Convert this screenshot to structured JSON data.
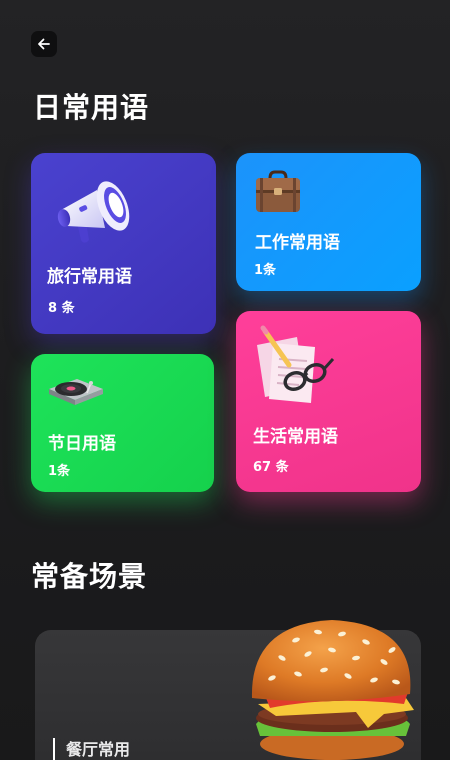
{
  "header": {
    "back_icon": "arrow-left-icon"
  },
  "daily": {
    "title": "日常用语",
    "cards": [
      {
        "label": "旅行常用语",
        "count": "8 条",
        "icon": "megaphone-icon",
        "color": "#4338ca"
      },
      {
        "label": "工作常用语",
        "count": "1条",
        "icon": "briefcase-icon",
        "color": "#0ea5ff"
      },
      {
        "label": "节日用语",
        "count": "1条",
        "icon": "turntable-icon",
        "color": "#22e05a"
      },
      {
        "label": "生活常用语",
        "count": "67 条",
        "icon": "documents-glasses-icon",
        "color": "#ff3d97"
      }
    ]
  },
  "scenes": {
    "title": "常备场景",
    "cards": [
      {
        "label": "餐厅常用",
        "icon": "burger-icon"
      }
    ]
  }
}
